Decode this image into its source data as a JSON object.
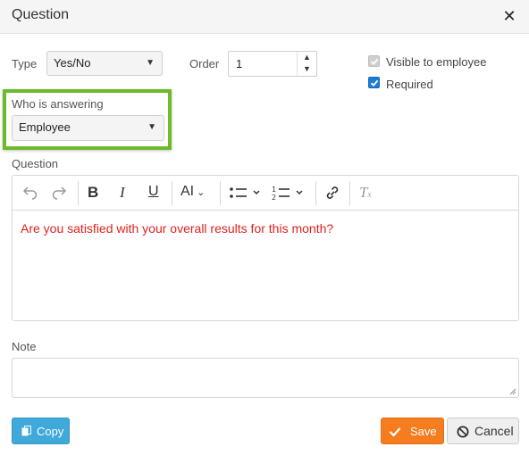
{
  "dialog": {
    "title": "Question",
    "close_icon": "close-icon"
  },
  "type_field": {
    "label": "Type",
    "value": "Yes/No"
  },
  "order_field": {
    "label": "Order",
    "value": "1"
  },
  "visible_checkbox": {
    "label": "Visible to employee",
    "checked": true,
    "disabled": true
  },
  "required_checkbox": {
    "label": "Required",
    "checked": true,
    "disabled": false
  },
  "answering_field": {
    "label": "Who is answering",
    "value": "Employee",
    "highlight_color": "#6dbb2a"
  },
  "question_editor": {
    "label": "Question",
    "content": "Are you satisfied with your overall results for this month?",
    "content_color": "#e0211d",
    "toolbar": [
      "undo-icon",
      "redo-icon",
      "bold-icon",
      "italic-icon",
      "underline-icon",
      "font-size-icon",
      "bullet-list-icon",
      "numbered-list-icon",
      "link-icon",
      "clear-formatting-icon"
    ]
  },
  "note_field": {
    "label": "Note",
    "value": ""
  },
  "buttons": {
    "copy": "Copy",
    "save": "Save",
    "cancel": "Cancel",
    "copy_color": "#3fa9d9",
    "save_color": "#f57c1f"
  }
}
